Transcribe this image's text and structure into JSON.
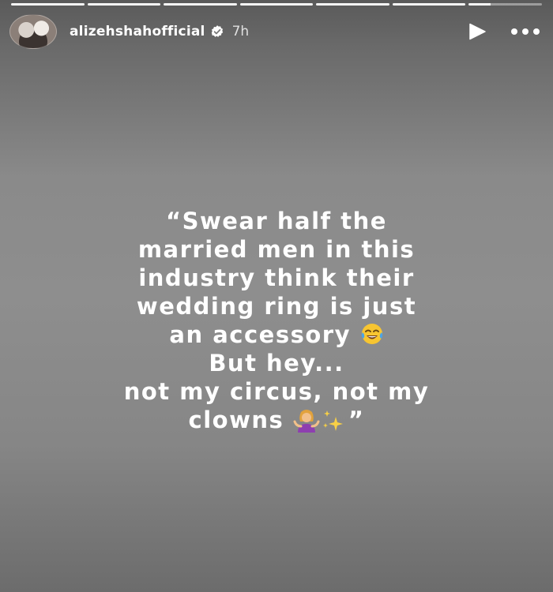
{
  "story": {
    "progress_segments": [
      1,
      1,
      1,
      1,
      1,
      1,
      0.3
    ],
    "username": "alizehshahofficial",
    "verified": true,
    "time_ago": "7h",
    "icons": {
      "avatar": "profile-avatar",
      "verified": "verified-badge-icon",
      "play": "play-icon",
      "more": "more-options-icon"
    },
    "caption_lines": [
      "“Swear half the",
      "married men in this",
      "industry think their",
      "wedding ring is just",
      "an accessory",
      "But hey...",
      "not my circus, not my",
      "clowns",
      "”"
    ],
    "emojis": {
      "laugh": "face-with-tears-of-joy-emoji",
      "shrug": "woman-shrugging-emoji",
      "sparkles": "sparkles-emoji"
    }
  }
}
